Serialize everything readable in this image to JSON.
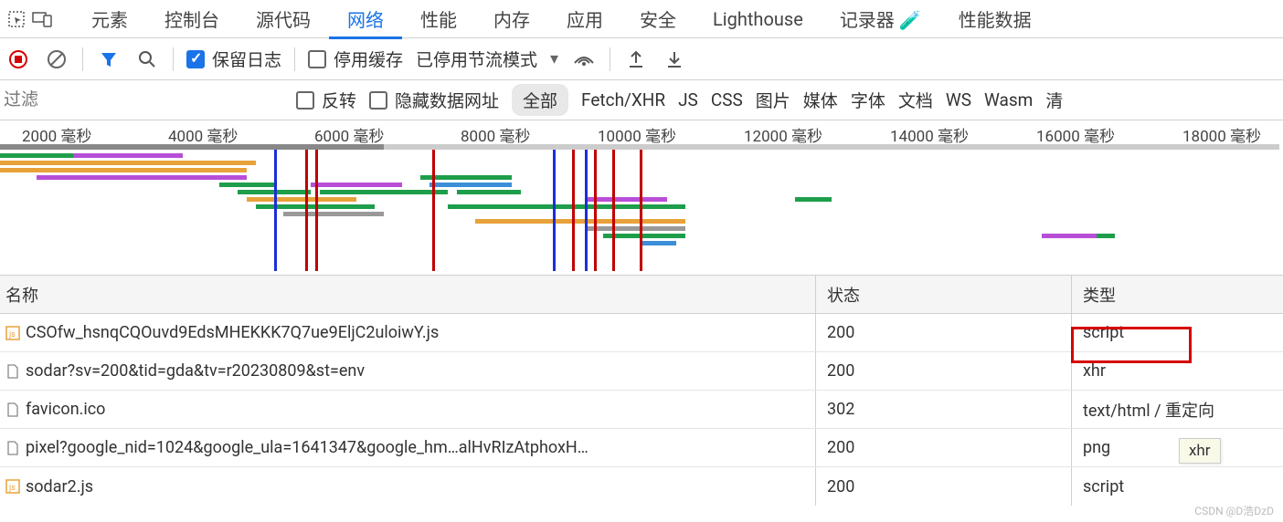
{
  "tabs": {
    "items": [
      "元素",
      "控制台",
      "源代码",
      "网络",
      "性能",
      "内存",
      "应用",
      "安全",
      "Lighthouse",
      "记录器 🧪",
      "性能数据"
    ],
    "active_index": 3
  },
  "toolbar": {
    "preserve_log_label": "保留日志",
    "disable_cache_label": "停用缓存",
    "throttling_label": "已停用节流模式"
  },
  "filter_row": {
    "filter_placeholder": "过滤",
    "invert_label": "反转",
    "hide_data_urls_label": "隐藏数据网址",
    "types": [
      "全部",
      "Fetch/XHR",
      "JS",
      "CSS",
      "图片",
      "媒体",
      "字体",
      "文档",
      "WS",
      "Wasm",
      "清"
    ],
    "active_type_index": 0
  },
  "timeline": {
    "ticks": [
      "2000 毫秒",
      "4000 毫秒",
      "6000 毫秒",
      "8000 毫秒",
      "10000 毫秒",
      "12000 毫秒",
      "14000 毫秒",
      "16000 毫秒",
      "18000 毫秒"
    ]
  },
  "table": {
    "headers": {
      "name": "名称",
      "status": "状态",
      "type": "类型"
    },
    "rows": [
      {
        "icon": "js",
        "name": "CSOfw_hsnqCQOuvd9EdsMHEKKK7Q7ue9EljC2uloiwY.js",
        "status": "200",
        "type": "script"
      },
      {
        "icon": "doc",
        "name": "sodar?sv=200&tid=gda&tv=r20230809&st=env",
        "status": "200",
        "type": "xhr"
      },
      {
        "icon": "doc",
        "name": "favicon.ico",
        "status": "302",
        "type": "text/html / 重定向"
      },
      {
        "icon": "doc",
        "name": "pixel?google_nid=1024&google_ula=1641347&google_hm…alHvRIzAtphoxH…",
        "status": "200",
        "type": "png"
      },
      {
        "icon": "js",
        "name": "sodar2.js",
        "status": "200",
        "type": "script"
      }
    ]
  },
  "tooltip": {
    "text": "xhr"
  },
  "watermark": "CSDN @D浩DzD"
}
